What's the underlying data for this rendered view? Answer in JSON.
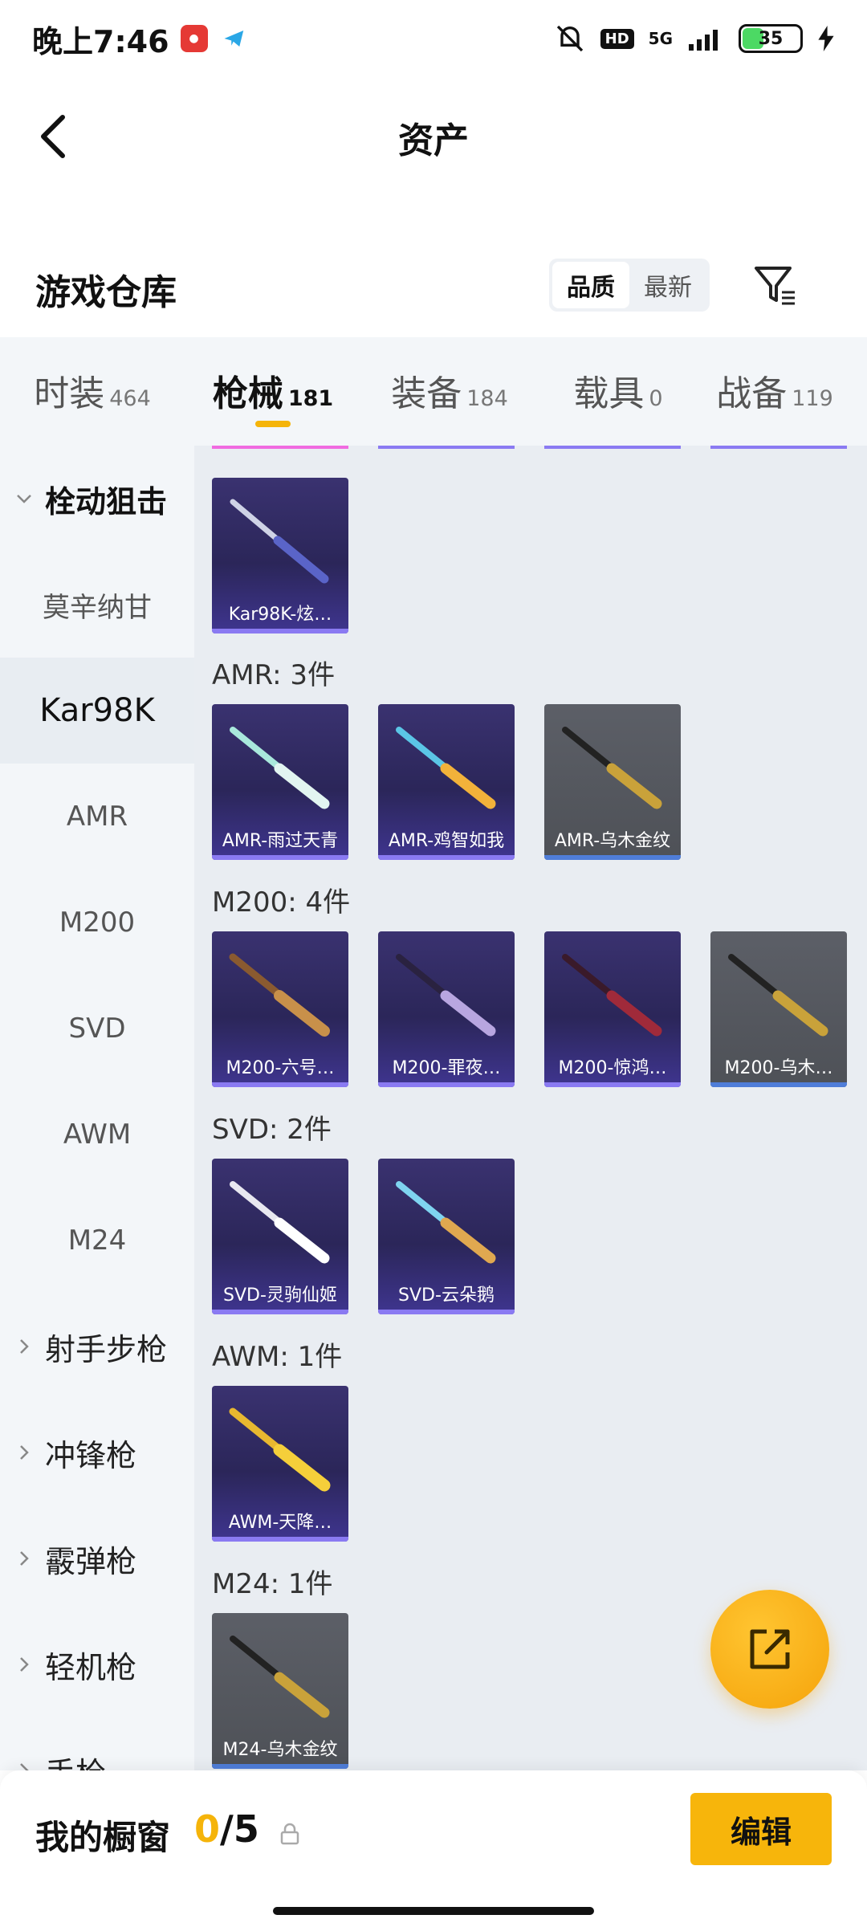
{
  "status_bar": {
    "time": "晚上7:46",
    "network": "5G",
    "hd_label": "HD",
    "battery": "35",
    "battery_level": 0.35,
    "icons": [
      "app-notification-icon",
      "telegram-icon",
      "mute-icon",
      "hd-icon",
      "signal-icon",
      "battery-icon",
      "charging-icon"
    ]
  },
  "header": {
    "title": "资产",
    "back_icon": "chevron-left-icon"
  },
  "warehouse": {
    "title": "游戏仓库",
    "sort_options": [
      "品质",
      "最新"
    ],
    "active_sort": "品质",
    "filter_icon": "filter-icon"
  },
  "tabs": [
    {
      "label": "时装",
      "count": "464"
    },
    {
      "label": "枪械",
      "count": "181"
    },
    {
      "label": "装备",
      "count": "184"
    },
    {
      "label": "载具",
      "count": "0"
    },
    {
      "label": "战备",
      "count": "119"
    }
  ],
  "active_tab": "枪械",
  "sidebar": {
    "items": [
      {
        "label": "栓动狙击",
        "type": "group",
        "expanded": true
      },
      {
        "label": "莫辛纳甘",
        "type": "sub"
      },
      {
        "label": "Kar98K",
        "type": "sub",
        "selected": true
      },
      {
        "label": "AMR",
        "type": "sub"
      },
      {
        "label": "M200",
        "type": "sub"
      },
      {
        "label": "SVD",
        "type": "sub"
      },
      {
        "label": "AWM",
        "type": "sub"
      },
      {
        "label": "M24",
        "type": "sub"
      },
      {
        "label": "射手步枪",
        "type": "group"
      },
      {
        "label": "冲锋枪",
        "type": "group"
      },
      {
        "label": "霰弹枪",
        "type": "group"
      },
      {
        "label": "轻机枪",
        "type": "group"
      },
      {
        "label": "手枪",
        "type": "group"
      }
    ]
  },
  "sections": [
    {
      "title": "",
      "items": [
        {
          "name": "Kar98K-炫…",
          "style": "purple"
        }
      ]
    },
    {
      "title": "AMR: 3件",
      "items": [
        {
          "name": "AMR-雨过天青",
          "style": "purple"
        },
        {
          "name": "AMR-鸡智如我",
          "style": "purple"
        },
        {
          "name": "AMR-乌木金纹",
          "style": "grey"
        }
      ]
    },
    {
      "title": "M200: 4件",
      "items": [
        {
          "name": "M200-六号…",
          "style": "purple"
        },
        {
          "name": "M200-罪夜…",
          "style": "purple"
        },
        {
          "name": "M200-惊鸿…",
          "style": "purple"
        },
        {
          "name": "M200-乌木…",
          "style": "grey"
        }
      ]
    },
    {
      "title": "SVD: 2件",
      "items": [
        {
          "name": "SVD-灵驹仙姬",
          "style": "purple"
        },
        {
          "name": "SVD-云朵鹅",
          "style": "purple"
        }
      ]
    },
    {
      "title": "AWM: 1件",
      "items": [
        {
          "name": "AWM-天降…",
          "style": "purple"
        }
      ]
    },
    {
      "title": "M24: 1件",
      "items": [
        {
          "name": "M24-乌木金纹",
          "style": "grey"
        }
      ]
    }
  ],
  "colors": {
    "accent": "#f5b40a",
    "purple_rarity": "#8a7af2",
    "blue_rarity": "#4f7dd8",
    "pink_rarity": "#f06be0"
  },
  "fab": {
    "icon": "share-external-icon"
  },
  "showcase": {
    "title": "我的橱窗",
    "current": "0",
    "separator": "/",
    "total": "5",
    "lock_icon": "lock-icon",
    "edit_label": "编辑"
  }
}
